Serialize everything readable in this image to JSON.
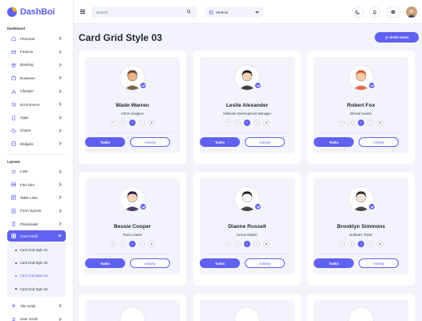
{
  "app": {
    "name": "DashBoi"
  },
  "topbar": {
    "search_placeholder": "Search",
    "layout_select": "Vertical"
  },
  "sidebar": {
    "section_dashboard": "Dashboard",
    "dashboard_items": [
      {
        "label": "Personal",
        "icon": "home-icon"
      },
      {
        "label": "Finance",
        "icon": "finance-icon"
      },
      {
        "label": "Banking",
        "icon": "bank-icon"
      },
      {
        "label": "Business",
        "icon": "briefcase-icon"
      },
      {
        "label": "Lifestyle",
        "icon": "lifestyle-icon"
      },
      {
        "label": "Ecommerce",
        "icon": "cart-icon"
      },
      {
        "label": "Apps",
        "icon": "apps-icon"
      },
      {
        "label": "Charts",
        "icon": "chart-icon"
      },
      {
        "label": "Widgets",
        "icon": "widgets-icon"
      }
    ],
    "section_layouts": "Layouts",
    "layout_items": [
      {
        "label": "Lists",
        "icon": "list-icon"
      },
      {
        "label": "Flex lists",
        "icon": "flex-list-icon"
      },
      {
        "label": "Table Lists",
        "icon": "table-icon"
      },
      {
        "label": "Form layouts",
        "icon": "form-icon"
      },
      {
        "label": "Placeloads",
        "icon": "placeload-icon"
      }
    ],
    "active_item": "Card Grids",
    "sub_items": [
      "Card Grid Style 01",
      "Card Grid Style 02",
      "Card Grid Style 03",
      "Card Grid Style 04"
    ],
    "after_items": [
      {
        "label": "Tile Grids",
        "icon": "tile-icon"
      },
      {
        "label": "User Grids",
        "icon": "user-grid-icon"
      }
    ]
  },
  "page": {
    "title": "Card Grid Style 03",
    "invite_label": "Invite Users",
    "tasks_label": "Tasks",
    "activity_label": "Activity"
  },
  "cards": [
    {
      "name": "Wade Warren",
      "role": "UI/UX designer",
      "hair": "#6b4a2a",
      "skin": "#e6b48a"
    },
    {
      "name": "Leslie Alexander",
      "role": "Software Development Manager",
      "hair": "#1d1d1d",
      "skin": "#f1d2b8"
    },
    {
      "name": "Robert Fox",
      "role": "Ethical Hacker",
      "hair": "#d7552b",
      "skin": "#f3c9a6"
    },
    {
      "name": "Bessie Cooper",
      "role": "Team Leader",
      "hair": "#2b1d4a",
      "skin": "#f6d3bd"
    },
    {
      "name": "Dianne Russell",
      "role": "Scrum Master",
      "hair": "#222222",
      "skin": "#ffffff"
    },
    {
      "name": "Brooklyn Simmons",
      "role": "Software Tester",
      "hair": "#2a2a2a",
      "skin": "#f7e3d2"
    }
  ],
  "colors": {
    "accent": "#6061f0",
    "background": "#f3f4fb",
    "card": "#ffffff"
  }
}
